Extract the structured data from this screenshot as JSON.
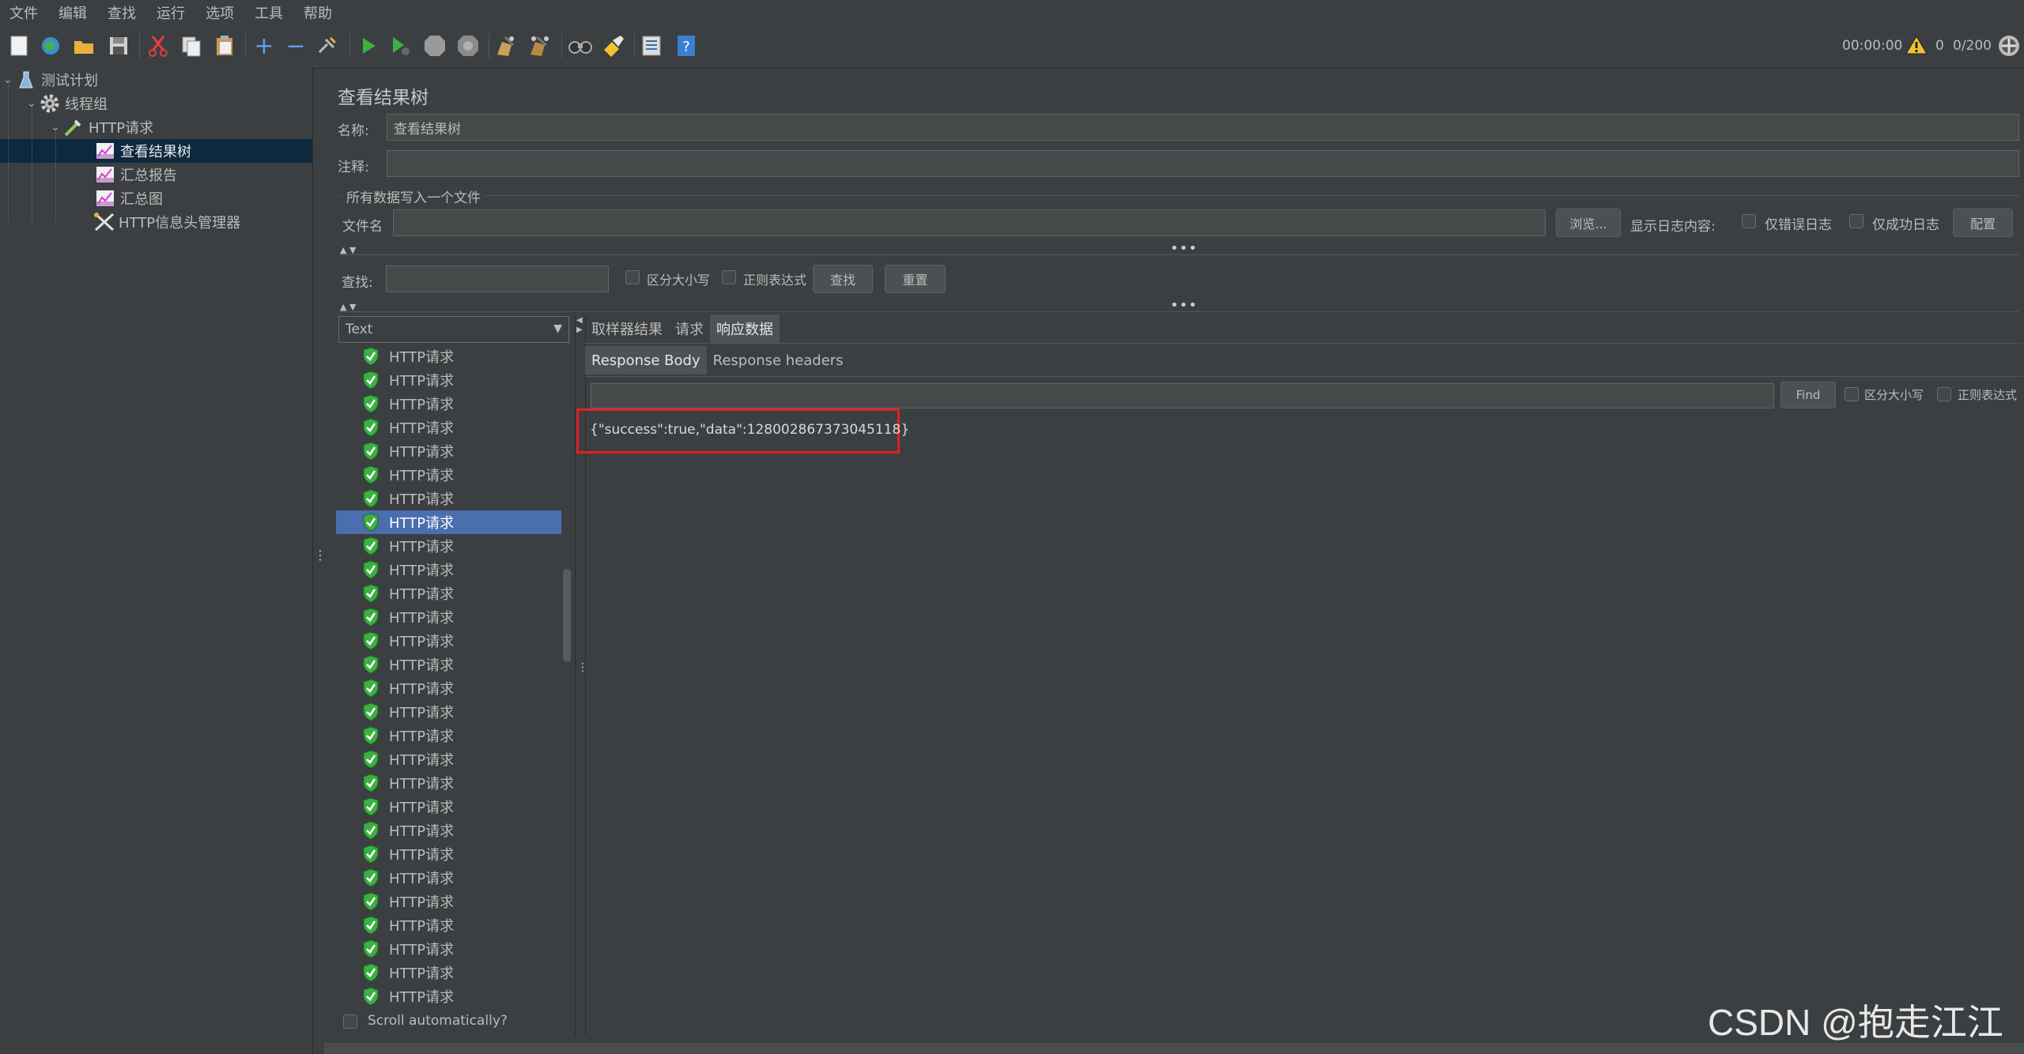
{
  "menu": [
    "文件",
    "编辑",
    "查找",
    "运行",
    "选项",
    "工具",
    "帮助"
  ],
  "status": {
    "timer": "00:00:00",
    "warnings": "0",
    "threads": "0/200"
  },
  "tree": {
    "test_plan": "测试计划",
    "thread_group": "线程组",
    "http_request": "HTTP请求",
    "view_results_tree": "查看结果树",
    "summary_report": "汇总报告",
    "summary_graph": "汇总图",
    "header_manager": "HTTP信息头管理器"
  },
  "panel": {
    "title": "查看结果树",
    "name_label": "名称:",
    "name_value": "查看结果树",
    "comment_label": "注释:",
    "comment_value": "",
    "file_group": "所有数据写入一个文件",
    "file_label": "文件名",
    "file_value": "",
    "browse": "浏览...",
    "log_label": "显示日志内容:",
    "errors_only": "仅错误日志",
    "success_only": "仅成功日志",
    "configure": "配置",
    "search_label": "查找:",
    "search_value": "",
    "case_sensitive": "区分大小写",
    "regex": "正则表达式",
    "find_btn": "查找",
    "reset_btn": "重置"
  },
  "renderer": "Text",
  "results": {
    "item_label": "HTTP请求",
    "count": 28,
    "selected_index": 7,
    "scroll_auto": "Scroll automatically?"
  },
  "tabs": [
    "取样器结果",
    "请求",
    "响应数据"
  ],
  "active_tab": 2,
  "subtabs": [
    "Response Body",
    "Response headers"
  ],
  "active_subtab": 0,
  "response": {
    "find_value": "",
    "find_btn": "Find",
    "case_sensitive": "区分大小写",
    "regex": "正则表达式",
    "body": "{\"success\":true,\"data\":1280028673730451​18}"
  },
  "watermark": "CSDN @抱走江江",
  "colors": {
    "background": "#3c3f41",
    "selection": "#4b6eaf",
    "tree_selection": "#0d293e",
    "highlight_box": "#e02020",
    "success_icon": "#4caf50"
  }
}
